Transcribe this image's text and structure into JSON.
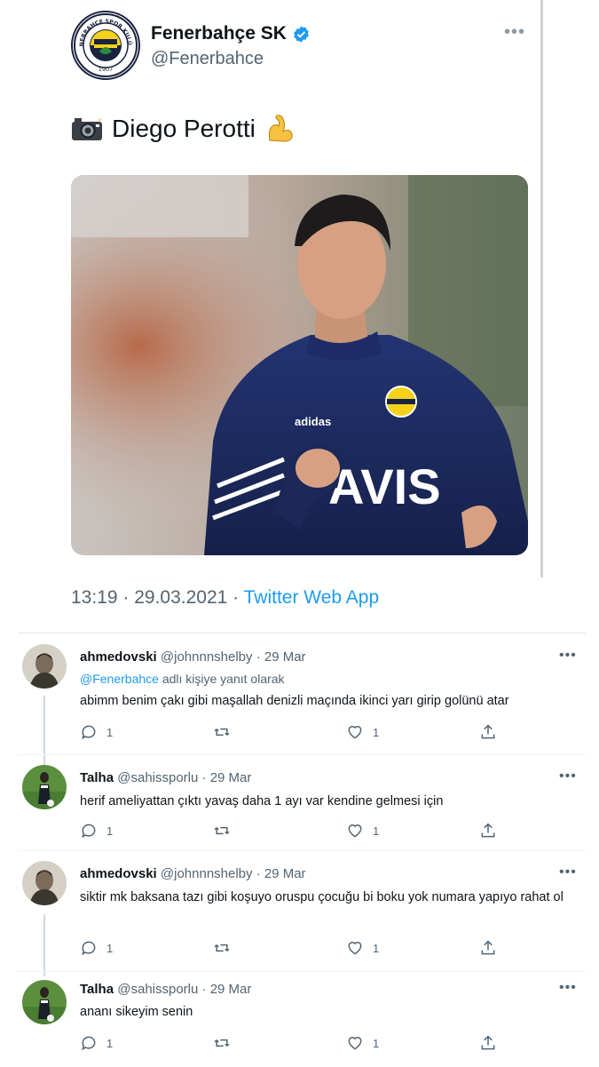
{
  "tweet": {
    "author_name": "Fenerbahçe SK",
    "author_handle": "@Fenerbahce",
    "logo_text": "FENERBAHÇE SPOR KULÜBÜ",
    "logo_year": "1907",
    "text": "Diego Perotti",
    "timestamp": "13:19 · 29.03.2021 · ",
    "source_app": "Twitter Web App",
    "photo_icons": [
      "camera-flash-icon",
      "flexed-biceps-icon"
    ],
    "verified_icon": "verified-badge-icon"
  },
  "replies": [
    {
      "name": "ahmedovski",
      "handle": "@johnnnshelby",
      "date": "· 29 Mar",
      "replying_prefix": "@Fenerbahce",
      "replying_suffix": " adlı kişiye yanıt olarak",
      "text": "abimm benim çakı gibi maşallah denizli maçında ikinci yarı girip golünü atar",
      "reply_count": "1",
      "like_count": "1"
    },
    {
      "name": "Talha",
      "handle": "@sahissporlu",
      "date": "· 29 Mar",
      "text": "herif ameliyattan çıktı yavaş daha 1 ayı var kendine gelmesi için",
      "reply_count": "1",
      "like_count": "1"
    },
    {
      "name": "ahmedovski",
      "handle": "@johnnnshelby",
      "date": "· 29 Mar",
      "text": "siktir mk baksana tazı gibi koşuyo oruspu çocuğu bi boku yok numara yapıyo rahat ol",
      "reply_count": "1",
      "like_count": "1"
    },
    {
      "name": "Talha",
      "handle": "@sahissporlu",
      "date": "· 29 Mar",
      "text": "ananı sikeyim senin",
      "reply_count": "1",
      "like_count": "1"
    }
  ],
  "colors": {
    "accent": "#1d9bf0",
    "secondary_text": "#536471",
    "jersey_navy": "#1c2a5c",
    "club_yellow": "#f4d21c"
  }
}
